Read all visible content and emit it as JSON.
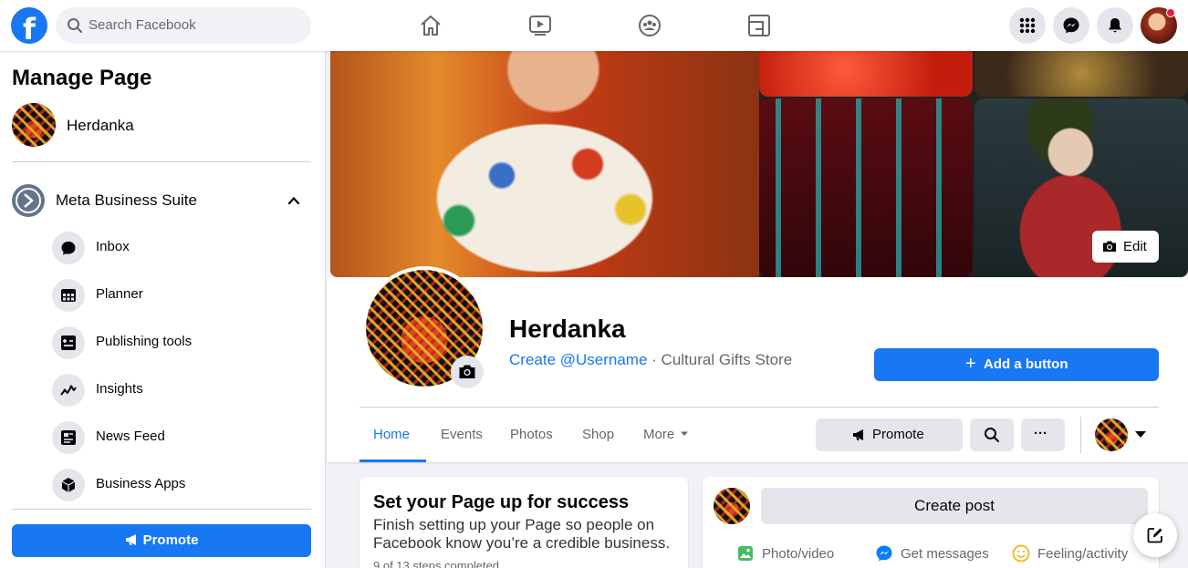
{
  "topbar": {
    "logo": "f",
    "search_placeholder": "Search Facebook",
    "nav_icons": [
      "home-icon",
      "video-icon",
      "groups-icon",
      "gaming-icon"
    ],
    "right_icons": [
      "menu-grid-icon",
      "messenger-icon",
      "notifications-icon"
    ]
  },
  "sidebar": {
    "title": "Manage Page",
    "page_name": "Herdanka",
    "suite_label": "Meta Business Suite",
    "items": [
      {
        "label": "Inbox",
        "icon": "inbox-icon"
      },
      {
        "label": "Planner",
        "icon": "planner-icon"
      },
      {
        "label": "Publishing tools",
        "icon": "publishing-tools-icon"
      },
      {
        "label": "Insights",
        "icon": "insights-icon"
      },
      {
        "label": "News Feed",
        "icon": "news-feed-icon"
      },
      {
        "label": "Business Apps",
        "icon": "business-apps-icon"
      }
    ],
    "promote_label": "Promote"
  },
  "cover": {
    "edit_label": "Edit"
  },
  "profile": {
    "name": "Herdanka",
    "username_link": "Create @Username",
    "separator": " · ",
    "category": "Cultural Gifts Store",
    "add_button_label": "Add a button",
    "add_button_plus": "+"
  },
  "tabs": [
    {
      "label": "Home",
      "active": true
    },
    {
      "label": "Events"
    },
    {
      "label": "Photos"
    },
    {
      "label": "Shop"
    },
    {
      "label": "More"
    }
  ],
  "actions": {
    "promote_label": "Promote",
    "more_label": "···"
  },
  "setup_card": {
    "title": "Set your Page up for success",
    "text": "Finish setting up your Page so people on Facebook know you’re a credible business.",
    "steps": "9 of 13 steps completed"
  },
  "composer": {
    "create_post_label": "Create post",
    "actions": [
      {
        "label": "Photo/video",
        "icon": "photo-video-icon"
      },
      {
        "label": "Get messages",
        "icon": "messenger-icon"
      },
      {
        "label": "Feeling/activity",
        "icon": "feeling-icon"
      }
    ]
  },
  "colors": {
    "brand": "#1877f2",
    "background": "#f0f2f5",
    "secondary_text": "#65676b"
  }
}
